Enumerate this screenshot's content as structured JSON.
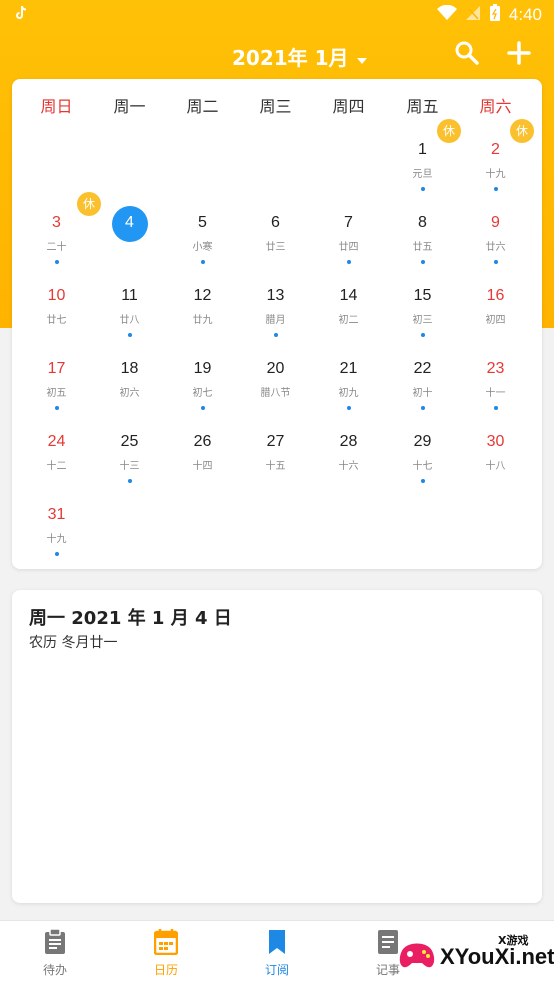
{
  "status_bar": {
    "left_icon": "tiktok-icon",
    "time": "4:40"
  },
  "header": {
    "title": "2021年 1月",
    "dropdown_icon": "caret-down-icon",
    "search_icon": "search-icon",
    "add_icon": "plus-icon"
  },
  "calendar": {
    "weekdays": [
      "周日",
      "周一",
      "周二",
      "周三",
      "周四",
      "周五",
      "周六"
    ],
    "rest_label": "休",
    "days": [
      {
        "day": "1",
        "lunar": "元旦",
        "dot": true,
        "rest": true
      },
      {
        "day": "2",
        "lunar": "十九",
        "dot": true,
        "rest": true
      },
      {
        "day": "3",
        "lunar": "二十",
        "dot": true,
        "rest": true
      },
      {
        "day": "4",
        "lunar": "",
        "dot": false,
        "selected": true
      },
      {
        "day": "5",
        "lunar": "小寒",
        "dot": true
      },
      {
        "day": "6",
        "lunar": "廿三",
        "dot": false
      },
      {
        "day": "7",
        "lunar": "廿四",
        "dot": true
      },
      {
        "day": "8",
        "lunar": "廿五",
        "dot": true
      },
      {
        "day": "9",
        "lunar": "廿六",
        "dot": true
      },
      {
        "day": "10",
        "lunar": "廿七",
        "dot": false
      },
      {
        "day": "11",
        "lunar": "廿八",
        "dot": true
      },
      {
        "day": "12",
        "lunar": "廿九",
        "dot": false
      },
      {
        "day": "13",
        "lunar": "腊月",
        "dot": true
      },
      {
        "day": "14",
        "lunar": "初二",
        "dot": false
      },
      {
        "day": "15",
        "lunar": "初三",
        "dot": true
      },
      {
        "day": "16",
        "lunar": "初四",
        "dot": false
      },
      {
        "day": "17",
        "lunar": "初五",
        "dot": true
      },
      {
        "day": "18",
        "lunar": "初六",
        "dot": false
      },
      {
        "day": "19",
        "lunar": "初七",
        "dot": true
      },
      {
        "day": "20",
        "lunar": "腊八节",
        "dot": false
      },
      {
        "day": "21",
        "lunar": "初九",
        "dot": true
      },
      {
        "day": "22",
        "lunar": "初十",
        "dot": true
      },
      {
        "day": "23",
        "lunar": "十一",
        "dot": true
      },
      {
        "day": "24",
        "lunar": "十二",
        "dot": false
      },
      {
        "day": "25",
        "lunar": "十三",
        "dot": true
      },
      {
        "day": "26",
        "lunar": "十四",
        "dot": false
      },
      {
        "day": "27",
        "lunar": "十五",
        "dot": false
      },
      {
        "day": "28",
        "lunar": "十六",
        "dot": false
      },
      {
        "day": "29",
        "lunar": "十七",
        "dot": true
      },
      {
        "day": "30",
        "lunar": "十八",
        "dot": false
      },
      {
        "day": "31",
        "lunar": "十九",
        "dot": true
      }
    ]
  },
  "detail": {
    "title": "周一  2021 年 1 月 4 日",
    "lunar": "农历 冬月廿一"
  },
  "bottom_nav": [
    {
      "label": "待办",
      "icon": "clipboard-icon"
    },
    {
      "label": "日历",
      "icon": "calendar-icon"
    },
    {
      "label": "订阅",
      "icon": "bookmark-icon"
    },
    {
      "label": "记事",
      "icon": "note-icon"
    }
  ],
  "watermark": {
    "text": "XYouXi.net",
    "small": "X游戏"
  },
  "colors": {
    "accent": "#ffb300",
    "selected": "#2196f3",
    "weekend": "#e53935",
    "rest": "#fbc02d"
  }
}
